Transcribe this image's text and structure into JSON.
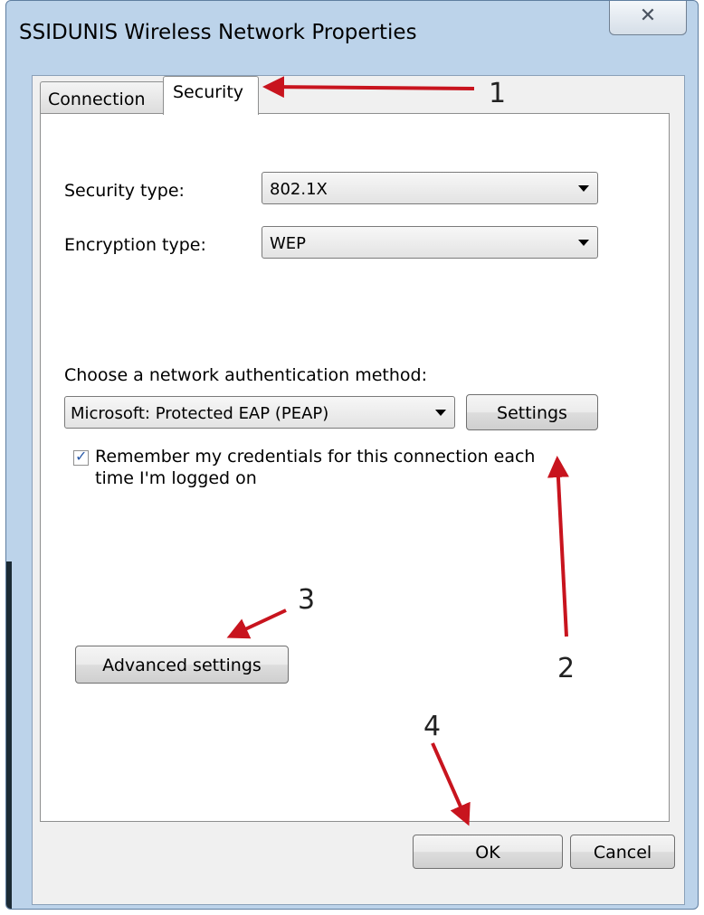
{
  "window": {
    "title": "SSIDUNIS Wireless Network Properties",
    "close_glyph": "✕"
  },
  "tabs": [
    {
      "label": "Connection"
    },
    {
      "label": "Security"
    }
  ],
  "security": {
    "security_type_label": "Security type:",
    "security_type_value": "802.1X",
    "encryption_type_label": "Encryption type:",
    "encryption_type_value": "WEP",
    "auth_method_label": "Choose a network authentication method:",
    "auth_method_value": "Microsoft: Protected EAP (PEAP)",
    "settings_button": "Settings",
    "remember_label": "Remember my credentials for this connection each time I'm logged on",
    "remember_checked": true,
    "advanced_button": "Advanced settings"
  },
  "buttons": {
    "ok": "OK",
    "cancel": "Cancel"
  },
  "annotations": {
    "numbers": [
      "1",
      "2",
      "3",
      "4"
    ],
    "arrow_color": "#c8141e"
  }
}
